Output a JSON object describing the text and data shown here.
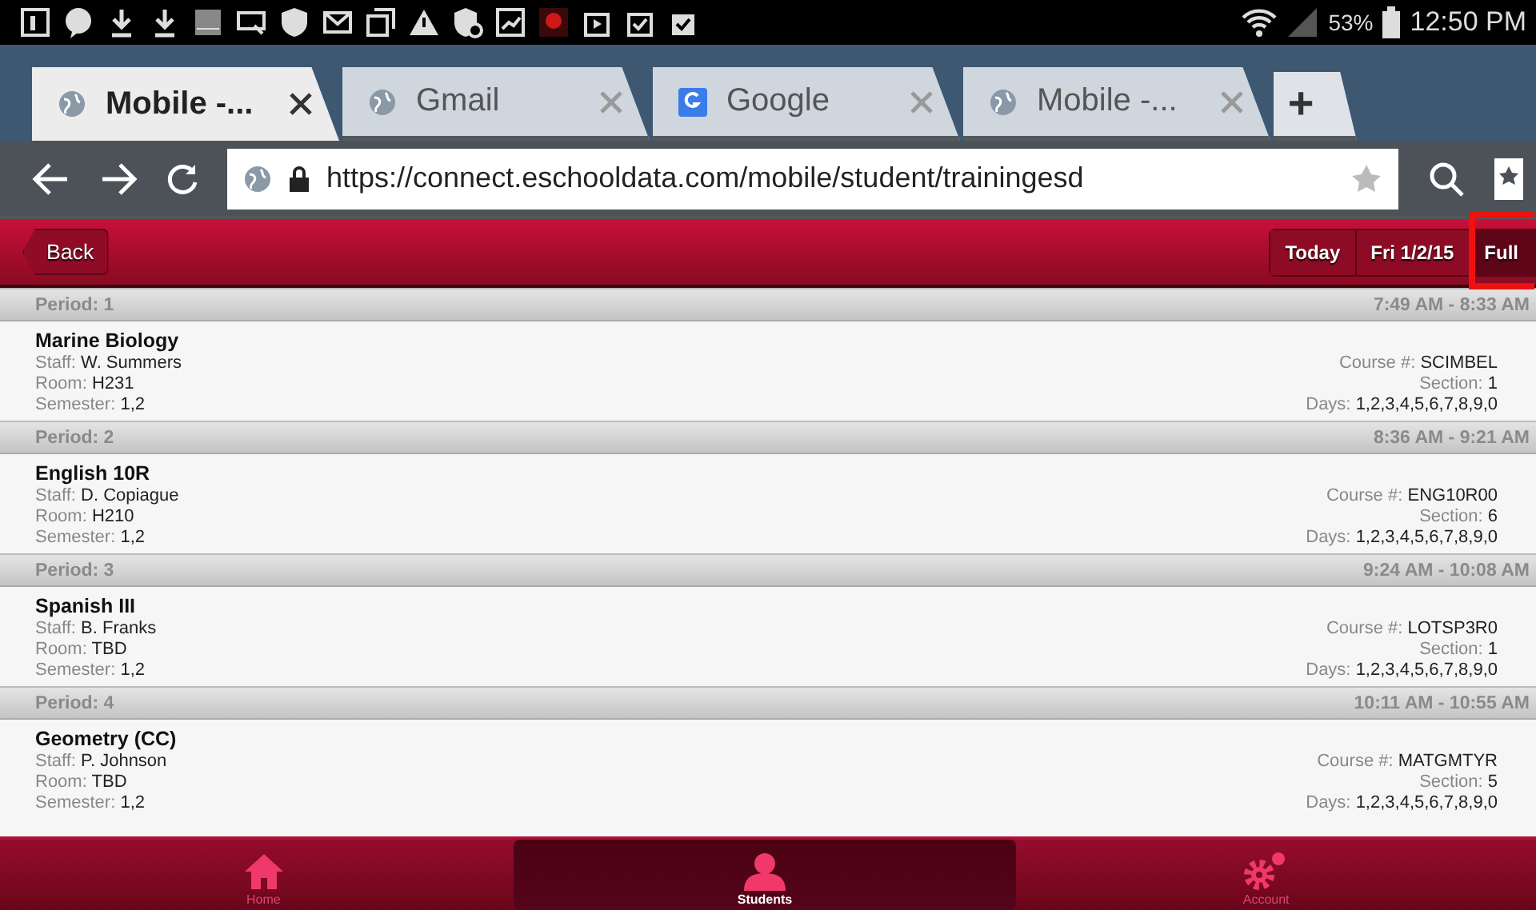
{
  "status_bar": {
    "battery": "53%",
    "time": "12:50 PM"
  },
  "browser_tabs": [
    {
      "title": "Mobile -...",
      "kind": "globe",
      "selected": true
    },
    {
      "title": "Gmail",
      "kind": "globe",
      "selected": false
    },
    {
      "title": "Google",
      "kind": "google",
      "selected": false
    },
    {
      "title": "Mobile -...",
      "kind": "globe",
      "selected": false
    }
  ],
  "new_tab": "+",
  "address_bar": {
    "url": "https://connect.eschooldata.com/mobile/student/trainingesd"
  },
  "header": {
    "back": "Back",
    "segments": [
      {
        "label": "Today",
        "selected": false,
        "highlighted": false
      },
      {
        "label": "Fri 1/2/15",
        "selected": false,
        "highlighted": false
      },
      {
        "label": "Full",
        "selected": true,
        "highlighted": true
      }
    ]
  },
  "periods": [
    {
      "period": "Period: 1",
      "time": "7:49 AM - 8:33 AM",
      "course": "Marine Biology",
      "details": [
        {
          "label": "Staff:",
          "value": "W. Summers"
        },
        {
          "label": "Room:",
          "value": "H231"
        },
        {
          "label": "Semester:",
          "value": "1,2"
        }
      ],
      "info": [
        {
          "label": "Course #:",
          "value": "SCIMBEL"
        },
        {
          "label": "Section:",
          "value": "1"
        },
        {
          "label": "Days:",
          "value": "1,2,3,4,5,6,7,8,9,0"
        }
      ]
    },
    {
      "period": "Period: 2",
      "time": "8:36 AM - 9:21 AM",
      "course": "English 10R",
      "details": [
        {
          "label": "Staff:",
          "value": "D. Copiague"
        },
        {
          "label": "Room:",
          "value": "H210"
        },
        {
          "label": "Semester:",
          "value": "1,2"
        }
      ],
      "info": [
        {
          "label": "Course #:",
          "value": "ENG10R00"
        },
        {
          "label": "Section:",
          "value": "6"
        },
        {
          "label": "Days:",
          "value": "1,2,3,4,5,6,7,8,9,0"
        }
      ]
    },
    {
      "period": "Period: 3",
      "time": "9:24 AM - 10:08 AM",
      "course": "Spanish III",
      "details": [
        {
          "label": "Staff:",
          "value": "B. Franks"
        },
        {
          "label": "Room:",
          "value": "TBD"
        },
        {
          "label": "Semester:",
          "value": "1,2"
        }
      ],
      "info": [
        {
          "label": "Course #:",
          "value": "LOTSP3R0"
        },
        {
          "label": "Section:",
          "value": "1"
        },
        {
          "label": "Days:",
          "value": "1,2,3,4,5,6,7,8,9,0"
        }
      ]
    },
    {
      "period": "Period: 4",
      "time": "10:11 AM - 10:55 AM",
      "course": "Geometry (CC)",
      "details": [
        {
          "label": "Staff:",
          "value": "P. Johnson"
        },
        {
          "label": "Room:",
          "value": "TBD"
        },
        {
          "label": "Semester:",
          "value": "1,2"
        }
      ],
      "info": [
        {
          "label": "Course #:",
          "value": "MATGMTYR"
        },
        {
          "label": "Section:",
          "value": "5"
        },
        {
          "label": "Days:",
          "value": "1,2,3,4,5,6,7,8,9,0"
        }
      ]
    }
  ],
  "bottom_nav": [
    {
      "label": "Home",
      "kind": "house",
      "selected": false
    },
    {
      "label": "Students",
      "kind": "person",
      "selected": true
    },
    {
      "label": "Account",
      "kind": "gears",
      "selected": false
    }
  ]
}
